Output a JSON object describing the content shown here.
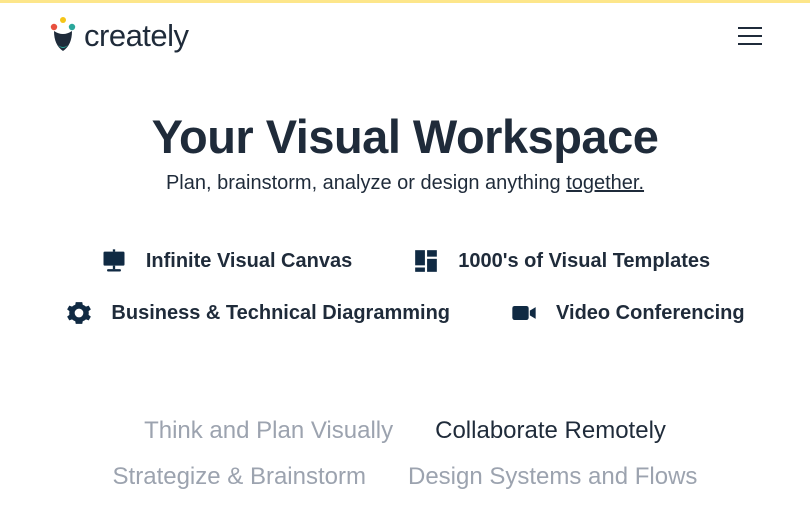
{
  "brand": {
    "name": "creately"
  },
  "hero": {
    "title": "Your Visual Workspace",
    "subtitle_prefix": "Plan, brainstorm, analyze or design anything ",
    "subtitle_emphasis": "together."
  },
  "features": {
    "canvas": "Infinite Visual Canvas",
    "templates": "1000's of Visual Templates",
    "diagramming": "Business & Technical Diagramming",
    "video": "Video Conferencing"
  },
  "tabs": {
    "think": "Think and Plan Visually",
    "collaborate": "Collaborate Remotely",
    "strategize": "Strategize & Brainstorm",
    "design": "Design Systems and Flows"
  }
}
